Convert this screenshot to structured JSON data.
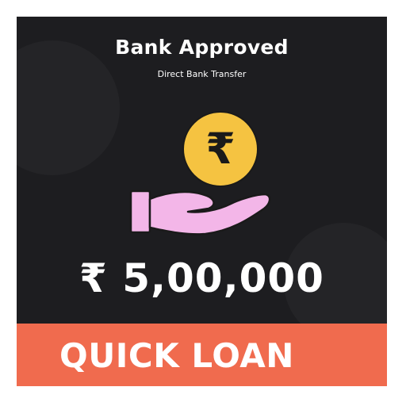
{
  "card": {
    "title": "Bank Approved",
    "subtitle": "Direct Bank Transfer",
    "amount": "₹ 5,00,000",
    "coin_symbol": "₹"
  },
  "banner": {
    "label": "QUICK LOAN"
  },
  "icons": {
    "coin": "rupee-coin-icon",
    "hand": "open-hand-icon"
  },
  "colors": {
    "card_background": "#1d1d20",
    "coin": "#f5c341",
    "hand": "#f3b6e8",
    "banner": "#f06b4e",
    "text": "#ffffff"
  }
}
